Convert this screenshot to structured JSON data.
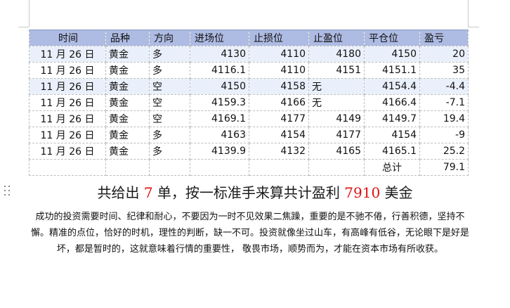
{
  "table": {
    "headers": [
      "时间",
      "品种",
      "方向",
      "进场位",
      "止损位",
      "止盈位",
      "平仓位",
      "盈亏"
    ],
    "rows": [
      [
        "11 月 26 日",
        "黄金",
        "多",
        "4130",
        "4110",
        "4180",
        "4150",
        "20"
      ],
      [
        "11 月 26 日",
        "黄金",
        "多",
        "4116.1",
        "4110",
        "4151",
        "4151.1",
        "35"
      ],
      [
        "11 月 26 日",
        "黄金",
        "空",
        "4150",
        "4158",
        "无",
        "4154.4",
        "-4.4"
      ],
      [
        "11 月 26 日",
        "黄金",
        "空",
        "4159.3",
        "4166",
        "无",
        "4166.4",
        "-7.1"
      ],
      [
        "11 月 26 日",
        "黄金",
        "空",
        "4169.1",
        "4177",
        "4149",
        "4149.7",
        "19.4"
      ],
      [
        "11 月 26 日",
        "黄金",
        "多",
        "4163",
        "4154",
        "4177",
        "4154",
        "-9"
      ],
      [
        "11 月 26 日",
        "黄金",
        "多",
        "4139.9",
        "4132",
        "4165",
        "4165.1",
        "25.2"
      ]
    ],
    "total_label": "总计",
    "total_value": "79.1"
  },
  "summary": {
    "part1": "共给出 ",
    "count": "7",
    "part2": " 单，按一标准手来算共计盈利 ",
    "profit": "7910",
    "part3": " 美金"
  },
  "paragraph": "成功的投资需要时间、纪律和耐心，不要因为一时不见效果二焦躁，重要的是不驰不倦，行善积德，坚持不懈。精准的点位，恰好的时机，理性的判断，缺一不可。投资就像坐过山车，有高峰有低谷，无论眼下是好是坏，都是暂时的，这就意味着行情的重要性， 敬畏市场，顺势而为，才能在资本市场有所收获。",
  "colors": {
    "header_bg": "#aebbe3",
    "row_shade": "#eaf0fb",
    "highlight": "#e01010"
  }
}
